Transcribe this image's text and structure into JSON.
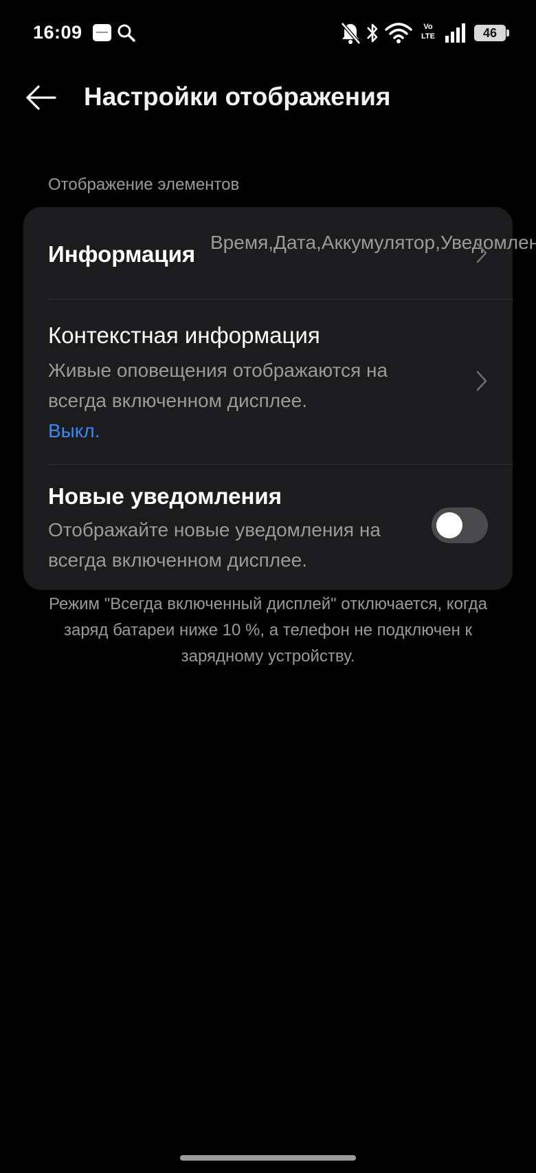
{
  "status_bar": {
    "time": "16:09",
    "network_label": "Vo\nLTE",
    "battery_level": "46"
  },
  "header": {
    "back_icon": "arrow-left-icon",
    "title": "Настройки отображения"
  },
  "section": {
    "label": "Отображение элементов"
  },
  "rows": {
    "info": {
      "title": "Информация",
      "value": "Время,Дата,Аккумулятор,Уведомления"
    },
    "context": {
      "title": "Контекстная информация",
      "description": "Живые оповещения отображаются на всегда включенном дисплее.",
      "status": "Выкл."
    },
    "notifications": {
      "title": "Новые уведомления",
      "description": "Отображайте новые уведомления на всегда включенном дисплее.",
      "toggle_on": false
    }
  },
  "footnote": "Режим \"Всегда включенный дисплей\" отключается, когда заряд батареи ниже 10 %, а телефон не подключен к зарядному устройству.",
  "colors": {
    "background": "#000000",
    "card": "#1c1c1e",
    "accent": "#3b87f5",
    "secondary_text": "#9a9a9a"
  }
}
